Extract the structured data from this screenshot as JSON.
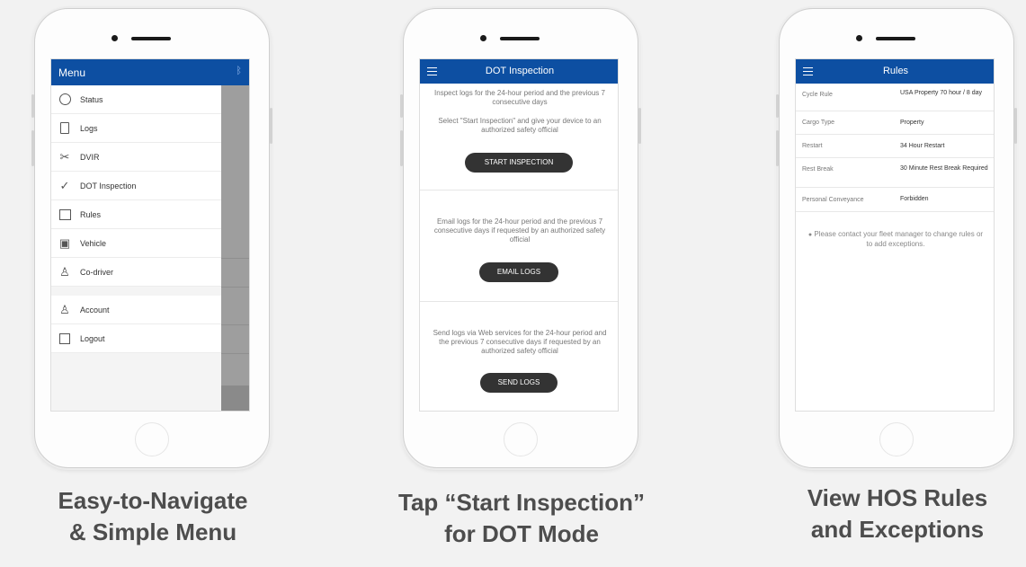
{
  "menu_phone": {
    "header": "Menu",
    "bluetooth_icon": "bluetooth-icon",
    "items": [
      {
        "label": "Status",
        "icon": "clock-icon"
      },
      {
        "label": "Logs",
        "icon": "document-icon"
      },
      {
        "label": "DVIR",
        "icon": "tools-icon"
      },
      {
        "label": "DOT Inspection",
        "icon": "check-circle-icon"
      },
      {
        "label": "Rules",
        "icon": "list-icon"
      },
      {
        "label": "Vehicle",
        "icon": "truck-icon"
      },
      {
        "label": "Co-driver",
        "icon": "user-icon"
      }
    ],
    "account_items": [
      {
        "label": "Account",
        "icon": "user-icon"
      },
      {
        "label": "Logout",
        "icon": "logout-icon"
      }
    ],
    "header_color": "#0d4fa2"
  },
  "dot_phone": {
    "title": "DOT Inspection",
    "inspect_text_1": "Inspect logs for the 24-hour period and the previous 7 consecutive days",
    "inspect_text_2": "Select \"Start Inspection\" and give your device to an authorized safety official",
    "start_button": "START INSPECTION",
    "email_text": "Email logs for the 24-hour period and the previous 7 consecutive days if requested by an authorized safety official",
    "email_button": "EMAIL LOGS",
    "send_text": "Send logs via Web services for the 24-hour period and the previous 7 consecutive days if requested by an authorized safety official",
    "send_button": "SEND LOGS"
  },
  "rules_phone": {
    "title": "Rules",
    "rows": [
      {
        "label": "Cycle Rule",
        "value": "USA Property 70 hour / 8 day"
      },
      {
        "label": "Cargo Type",
        "value": "Property"
      },
      {
        "label": "Restart",
        "value": "34 Hour Restart"
      },
      {
        "label": "Rest Break",
        "value": "30 Minute Rest Break Required"
      },
      {
        "label": "Personal Conveyance",
        "value": "Forbidden"
      }
    ],
    "note": "Please contact your fleet manager to change rules or to add exceptions."
  },
  "captions": {
    "menu_line1": "Easy-to-Navigate",
    "menu_line2": "& Simple Menu",
    "dot_line1": "Tap “Start Inspection”",
    "dot_line2": "for DOT Mode",
    "rules_line1": "View HOS Rules",
    "rules_line2": "and Exceptions"
  }
}
